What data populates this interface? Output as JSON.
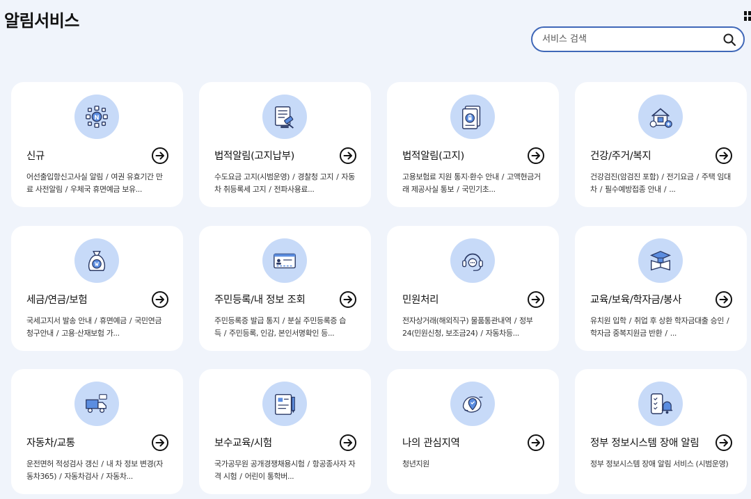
{
  "header": {
    "title": "알림서비스"
  },
  "search": {
    "placeholder": "서비스 검색"
  },
  "cards": [
    {
      "title": "신규",
      "icon": "sparkle-badge-icon",
      "items": [
        "어선출입항신고사실 알림",
        "여권 유효기간 만료 사전알림",
        "우체국 휴면예금 보유..."
      ]
    },
    {
      "title": "법적알림(고지납부)",
      "icon": "document-gavel-icon",
      "items": [
        "수도요금 고지(시범운영)",
        "경찰청 고지",
        "자동차 취등록세 고지",
        "전파사용료..."
      ]
    },
    {
      "title": "법적알림(고지)",
      "icon": "document-lock-icon",
      "items": [
        "고용보험료 지원 통지·환수 안내",
        "고액현금거래 제공사실 통보",
        "국민기초..."
      ]
    },
    {
      "title": "건강/주거/복지",
      "icon": "house-care-icon",
      "items": [
        "건강검진(암검진 포함)",
        "전기요금",
        "주택 임대차",
        "필수예방접종 안내",
        "..."
      ]
    },
    {
      "title": "세금/연금/보험",
      "icon": "money-bag-icon",
      "items": [
        "국세고지서 발송 안내",
        "휴면예금",
        "국민연금 청구안내",
        "고용·산재보험 가..."
      ]
    },
    {
      "title": "주민등록/내 정보 조회",
      "icon": "id-card-icon",
      "items": [
        "주민등록증 발급 통지",
        "분실 주민등록증 습득",
        "주민등록, 인감, 본인서명확인 등..."
      ]
    },
    {
      "title": "민원처리",
      "icon": "headset-icon",
      "items": [
        "전자상거래(해외직구) 물품통관내역",
        "정부24(민원신청, 보조금24)",
        "자동차등..."
      ]
    },
    {
      "title": "교육/보육/학자금/봉사",
      "icon": "graduation-book-icon",
      "items": [
        "유치원 입학",
        "취업 후 상환 학자금대출 승인",
        "학자금 중복지원금 반환",
        "..."
      ]
    },
    {
      "title": "자동차/교통",
      "icon": "truck-icon",
      "items": [
        "운전면허 적성검사 갱신",
        "내 차 정보 변경(자동차365)",
        "자동차검사",
        "자동차..."
      ]
    },
    {
      "title": "보수교육/시험",
      "icon": "exam-pencil-icon",
      "items": [
        "국가공무원 공개경쟁채용시험",
        "항공종사자 자격 시험",
        "어린이 통학버..."
      ]
    },
    {
      "title": "나의 관심지역",
      "icon": "map-pin-icon",
      "items": [
        "청년지원"
      ]
    },
    {
      "title": "정부 정보시스템 장애 알림",
      "icon": "phone-bell-icon",
      "items": [
        "정부 정보시스템 장애 알림 서비스 (시범운영)"
      ]
    }
  ]
}
